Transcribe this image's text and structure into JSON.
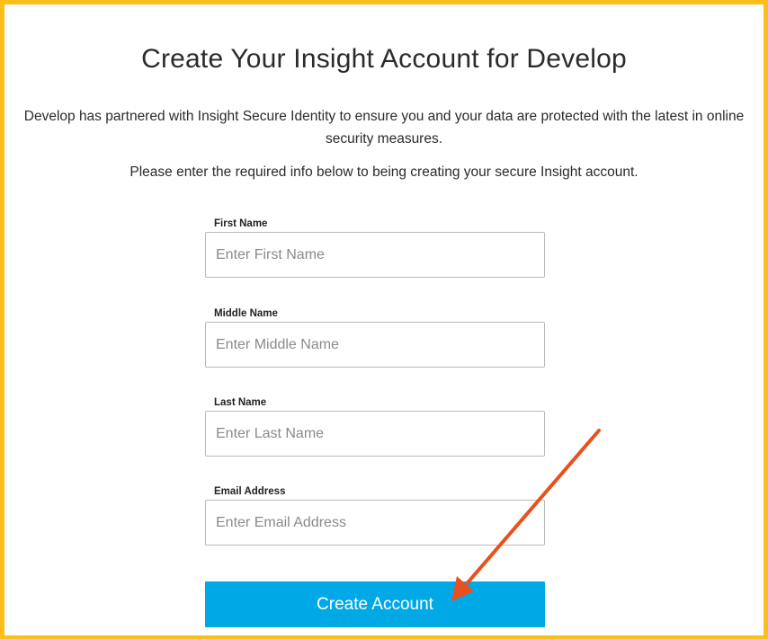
{
  "page": {
    "title": "Create Your Insight Account for Develop",
    "description": "Develop has partnered with Insight Secure Identity to ensure you and your data are protected with the latest in online security measures.",
    "instruction": "Please enter the required info below to being creating your secure Insight account."
  },
  "form": {
    "first_name": {
      "label": "First Name",
      "placeholder": "Enter First Name",
      "value": ""
    },
    "middle_name": {
      "label": "Middle Name",
      "placeholder": "Enter Middle Name",
      "value": ""
    },
    "last_name": {
      "label": "Last Name",
      "placeholder": "Enter Last Name",
      "value": ""
    },
    "email": {
      "label": "Email Address",
      "placeholder": "Enter Email Address",
      "value": ""
    },
    "submit_label": "Create Account"
  },
  "colors": {
    "frame_border": "#fbbf1a",
    "button_bg": "#00a9e6",
    "annotation_arrow": "#e8501f"
  },
  "icons": {
    "annotation": "arrow-pointer-icon"
  }
}
